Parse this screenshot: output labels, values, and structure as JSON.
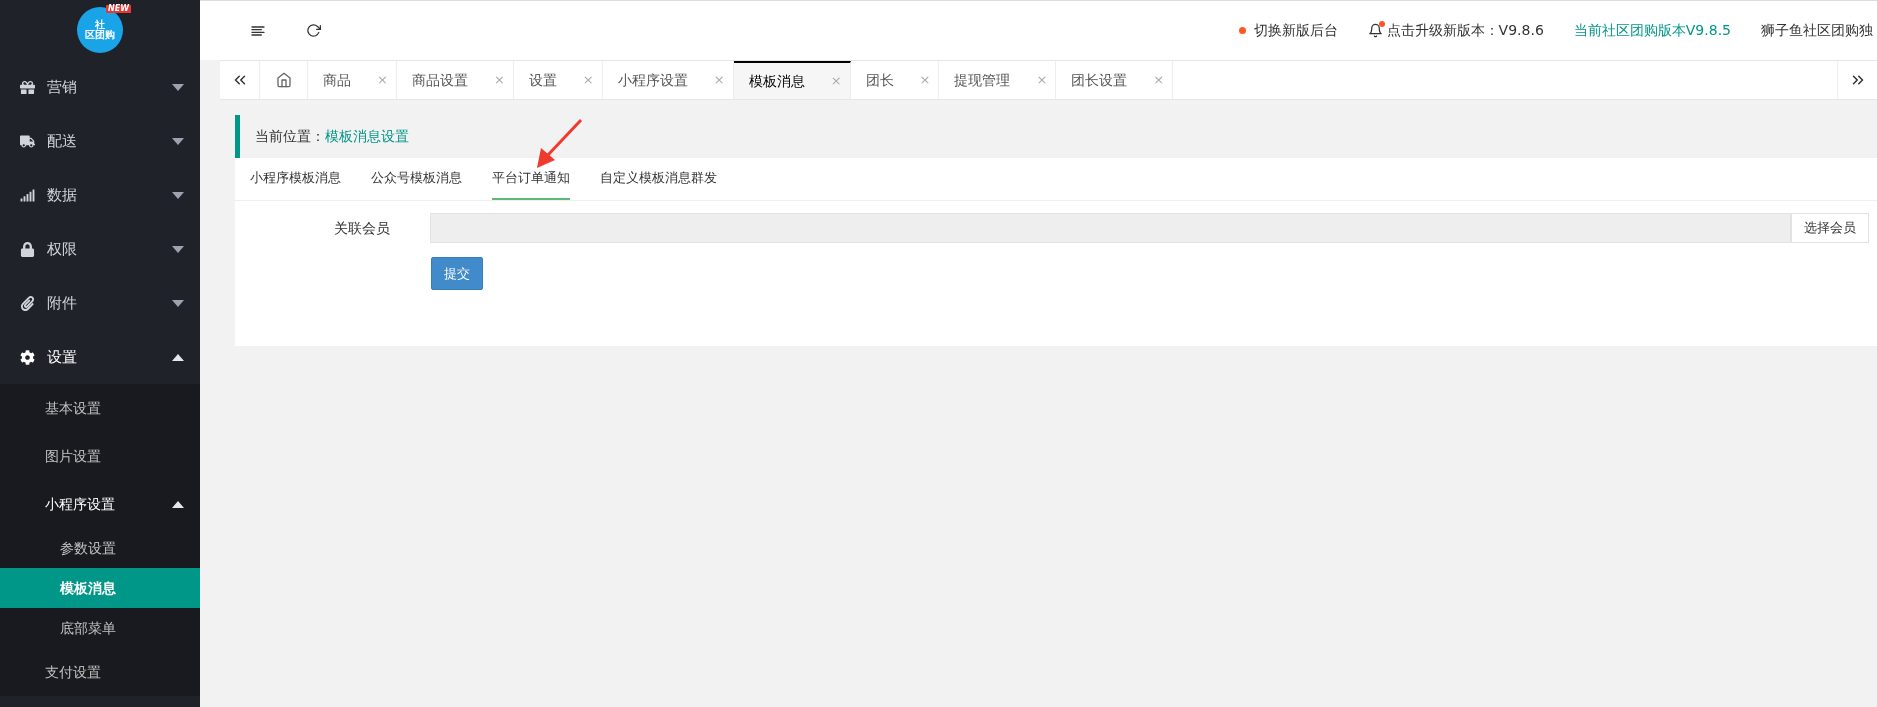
{
  "sidebar": {
    "logo": {
      "line_1": "社",
      "line_2": "区团购",
      "badge": "NEW"
    },
    "items": [
      {
        "label": "营销",
        "expanded": false
      },
      {
        "label": "配送",
        "expanded": false
      },
      {
        "label": "数据",
        "expanded": false
      },
      {
        "label": "权限",
        "expanded": false
      },
      {
        "label": "附件",
        "expanded": false
      },
      {
        "label": "设置",
        "expanded": true,
        "children": [
          {
            "label": "基本设置",
            "selected": false
          },
          {
            "label": "图片设置",
            "selected": false
          },
          {
            "label": "小程序设置",
            "selected": false,
            "expanded": true,
            "children": [
              {
                "label": "参数设置",
                "selected": false
              },
              {
                "label": "模板消息",
                "selected": true
              },
              {
                "label": "底部菜单",
                "selected": false
              }
            ]
          },
          {
            "label": "支付设置",
            "selected": false
          }
        ]
      }
    ]
  },
  "header": {
    "switch_notice": "切换新版后台",
    "upgrade_notice": "点击升级新版本：V9.8.6",
    "current_version": "当前社区团购版本V9.8.5",
    "site_name": "狮子鱼社区团购独"
  },
  "tab_bar": {
    "close_mark": "×",
    "tabs": [
      {
        "label": "商品",
        "selected": false
      },
      {
        "label": "商品设置",
        "selected": false
      },
      {
        "label": "设置",
        "selected": false
      },
      {
        "label": "小程序设置",
        "selected": false
      },
      {
        "label": "模板消息",
        "selected": true
      },
      {
        "label": "团长",
        "selected": false
      },
      {
        "label": "提现管理",
        "selected": false
      },
      {
        "label": "团长设置",
        "selected": false
      }
    ]
  },
  "breadcrumb": {
    "label": "当前位置：",
    "current": "模板消息设置"
  },
  "sub_tabs": [
    {
      "label": "小程序模板消息",
      "selected": false
    },
    {
      "label": "公众号模板消息",
      "selected": false
    },
    {
      "label": "平台订单通知",
      "selected": true
    },
    {
      "label": "自定义模板消息群发",
      "selected": false
    }
  ],
  "form": {
    "field_label": "关联会员",
    "pick_button": "选择会员",
    "submit_button": "提交"
  }
}
